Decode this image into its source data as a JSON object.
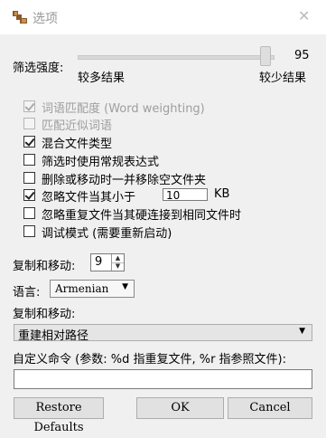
{
  "window": {
    "title": "选项",
    "close_glyph": "✕",
    "app_icon": "app-logo-icon"
  },
  "filter": {
    "label": "筛选强度:",
    "value": "95",
    "min_label": "较多结果",
    "max_label": "较少结果",
    "level": 95
  },
  "options": [
    {
      "label": "词语匹配度 (Word weighting)",
      "checked": true,
      "disabled": true
    },
    {
      "label": "匹配近似词语",
      "checked": false,
      "disabled": true
    },
    {
      "label": "混合文件类型",
      "checked": true,
      "disabled": false
    },
    {
      "label": "筛选时使用常规表达式",
      "checked": false,
      "disabled": false
    },
    {
      "label": "删除或移动时一并移除空文件夹",
      "checked": false,
      "disabled": false
    },
    {
      "label": "忽略文件当其小于",
      "checked": true,
      "disabled": false,
      "input_value": "10",
      "unit": "KB"
    },
    {
      "label": "忽略重复文件当其硬连接到相同文件时",
      "checked": false,
      "disabled": false
    },
    {
      "label": "调试模式 (需要重新启动)",
      "checked": false,
      "disabled": false
    }
  ],
  "copy_move_count": {
    "label": "复制和移动:",
    "value": "9"
  },
  "language": {
    "label": "语言:",
    "value": "Armenian"
  },
  "copy_move_mode": {
    "label": "复制和移动:",
    "value": "重建相对路径"
  },
  "custom_command": {
    "label": "自定义命令 (参数: %d 指重复文件, %r 指参照文件):",
    "value": ""
  },
  "buttons": {
    "restore": "Restore Defaults",
    "ok": "OK",
    "cancel": "Cancel"
  }
}
